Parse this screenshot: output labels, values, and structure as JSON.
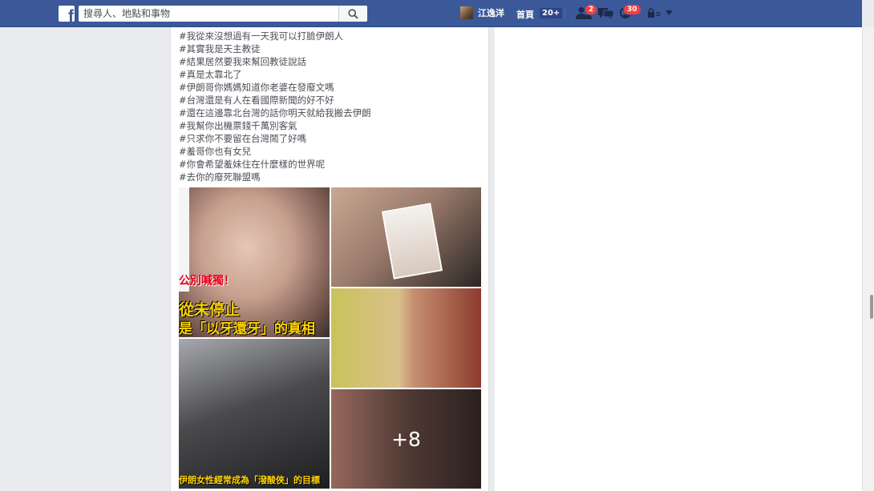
{
  "topbar": {
    "logo_letter": "f",
    "search_placeholder": "搜尋人、地點和事物",
    "user_name": "江逸洋",
    "home_label": "首頁",
    "home_count": "20+",
    "friend_requests_count": "2",
    "notifications_count": "30",
    "brand_color": "#3b5998"
  },
  "post": {
    "lines": [
      "#我從來沒想過有一天我可以打臉伊朗人",
      "#其實我是天主教徒",
      "#結果居然要我來幫回教徒說話",
      "#真是太靠北了",
      "#伊朗哥你媽媽知道你老婆在發廢文嗎",
      "#台灣還是有人在看國際新聞的好不好",
      "#還在這邊靠北台灣的話你明天就給我搬去伊朗",
      "#我幫你出機票錢千萬別客氣",
      "#只求你不要留在台灣鬧了好嗎",
      "#羞哥你也有女兒",
      "#你會希望羞妹住在什麼樣的世界呢",
      "#去你的廢死聯盟嗎"
    ],
    "photos": {
      "p1_caption_top": "公別喊獨！",
      "p1_caption_mid": "從未停止",
      "p1_caption_bottom": "是「以牙還牙」的真相",
      "p3_caption": "伊朗女性經常成為「潑酸俠」的目標",
      "more_label": "+8"
    }
  }
}
